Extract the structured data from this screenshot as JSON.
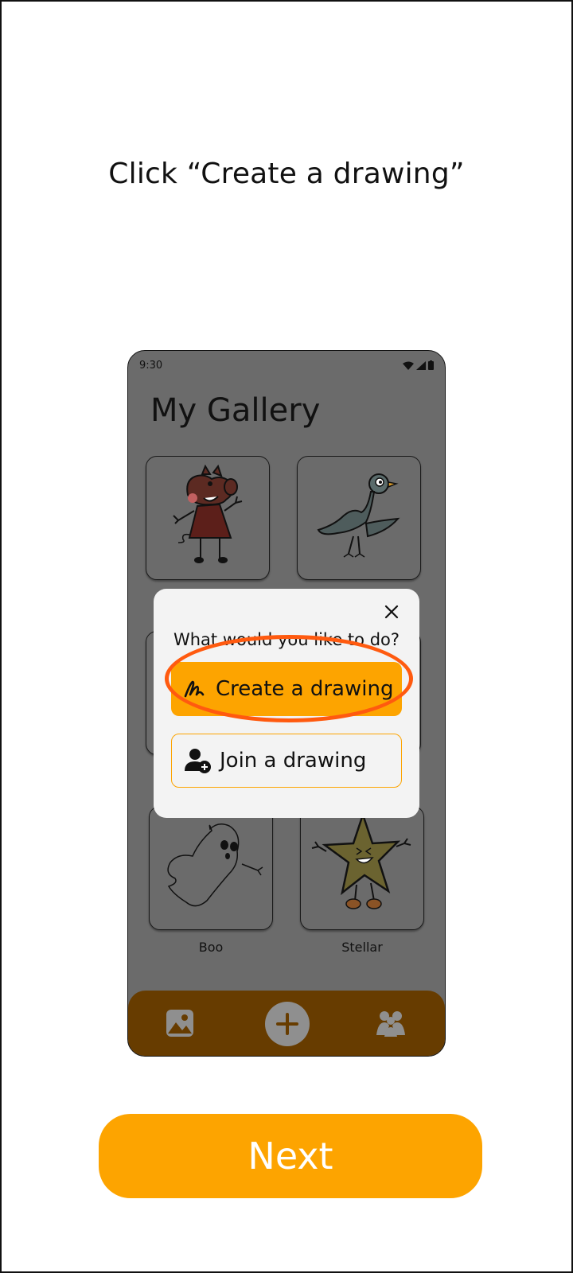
{
  "instruction": "Click “Create a drawing”",
  "phone": {
    "status_time": "9:30",
    "gallery_title": "My Gallery",
    "cards": [
      {
        "label": ""
      },
      {
        "label": ""
      },
      {
        "label": ""
      },
      {
        "label": ""
      },
      {
        "label": "Boo"
      },
      {
        "label": "Stellar"
      }
    ],
    "nav": {
      "items": [
        "gallery-icon",
        "add-icon",
        "group-icon"
      ]
    }
  },
  "dialog": {
    "question": "What would you like to do?",
    "create_label": "Create a drawing",
    "join_label": "Join a drawing"
  },
  "next_label": "Next",
  "colors": {
    "accent": "#fda400",
    "highlight": "#ff5a0f",
    "nav_bg": "#673c00",
    "overlay": "#6b6b6b"
  }
}
